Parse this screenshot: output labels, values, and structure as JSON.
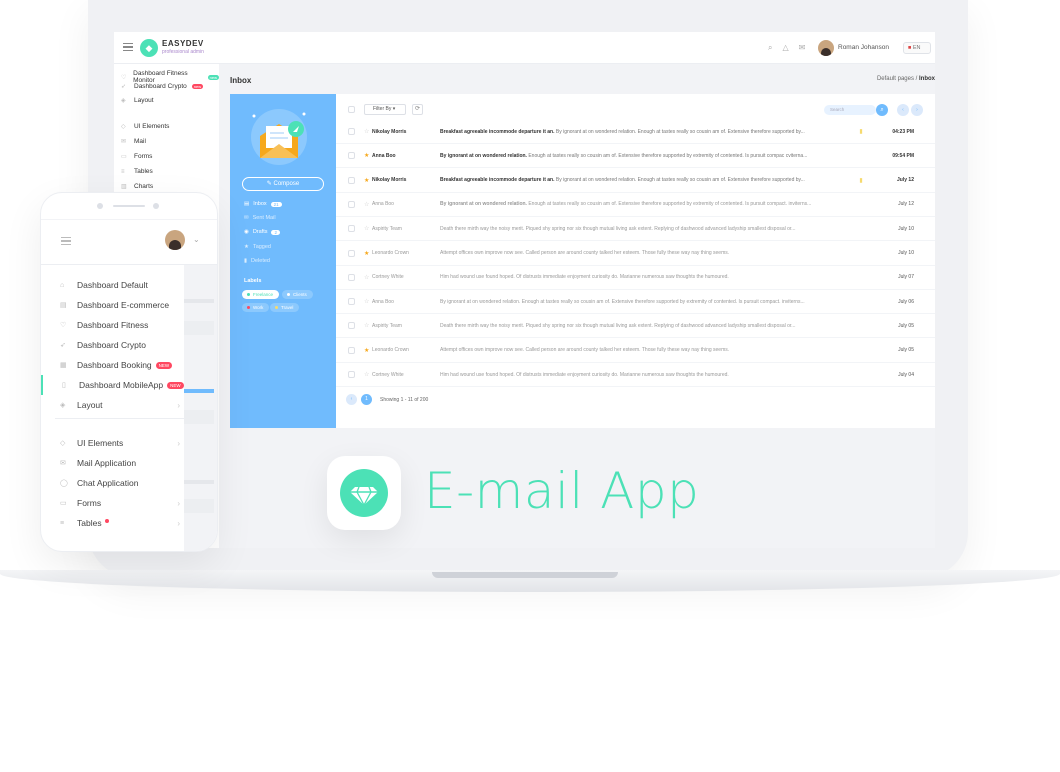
{
  "laptop": {
    "brand": {
      "name": "EASYDEV",
      "tagline": "professional admin"
    },
    "topbar": {
      "user": "Roman Johanson",
      "lang": "EN"
    },
    "sidebar": {
      "items": [
        {
          "label": "Dashboard Fitness Monitor",
          "badge": "new"
        },
        {
          "label": "Dashboard Crypto",
          "badge": "new"
        },
        {
          "label": "Layout"
        },
        {
          "label": "UI Elements"
        },
        {
          "label": "Mail"
        },
        {
          "label": "Forms"
        },
        {
          "label": "Tables"
        },
        {
          "label": "Charts"
        }
      ]
    },
    "page": {
      "title": "Inbox",
      "breadcrumb_parent": "Default pages",
      "breadcrumb_current": "Inbox"
    },
    "mail": {
      "compose": "Compose",
      "folders": [
        {
          "label": "Inbox",
          "count": "21"
        },
        {
          "label": "Sent Mail"
        },
        {
          "label": "Drafts",
          "count": "2"
        },
        {
          "label": "Tagged"
        },
        {
          "label": "Deleted"
        }
      ],
      "labels_title": "Labels",
      "labels": [
        {
          "label": "Freelance",
          "color": "#4ce1b6"
        },
        {
          "label": "Clients",
          "color": "#70bbfd"
        },
        {
          "label": "Work",
          "color": "#ff4861"
        },
        {
          "label": "Travel",
          "color": "#f6da6e"
        }
      ],
      "filter": "Filter By",
      "search_placeholder": "Search",
      "messages": [
        {
          "from": "Nikolay Morris",
          "subject": "Breakfast agreeable incommode departure it an.",
          "body": "By ignorant at on wondered relation. Enough at tastes really so cousin am of. Extensive therefore supported by...",
          "time": "04:23 PM",
          "unread": true,
          "starred": false,
          "attachment": true
        },
        {
          "from": "Anna Boo",
          "subject": "By ignorant at on wondered relation.",
          "body": "Enough at tastes really so cousin am of. Extensive therefore supported by extremity of contented. Is pursuit compac cviterna...",
          "time": "09:54 PM",
          "unread": true,
          "starred": true,
          "attachment": false
        },
        {
          "from": "Nikolay Morris",
          "subject": "Breakfast agreeable incommode departure it an.",
          "body": "By ignorant at on wondered relation. Enough at tastes really so cousin am of. Extensive therefore supported by...",
          "time": "July 12",
          "unread": true,
          "starred": true,
          "attachment": true
        },
        {
          "from": "Anna Boo",
          "subject": "By ignorant at on wondered relation.",
          "body": "Enough at tastes really so cousin am of. Extensive therefore supported by extremity of contented. Is pursuit compact. inviterns...",
          "time": "July 12",
          "unread": false,
          "starred": false,
          "attachment": false
        },
        {
          "from": "Aspirity Team",
          "subject": "",
          "body": "Death there mirth way the noisy merit. Piqued shy spring nor six though mutual living ask extent. Replying of dashwood advanced ladyship smallest disposal or...",
          "time": "July 10",
          "unread": false,
          "starred": false,
          "attachment": false
        },
        {
          "from": "Leonardo Crown",
          "subject": "",
          "body": "Attempt offices own improve now see. Called person are around county talked her esteem. Those fully these way nay thing seems.",
          "time": "July 10",
          "unread": false,
          "starred": true,
          "attachment": false
        },
        {
          "from": "Cortney White",
          "subject": "",
          "body": "Him had wound use found hoped. Of distrusts immediate enjoyment curiosity do. Marianne numerous saw thoughts the humoured.",
          "time": "July 07",
          "unread": false,
          "starred": false,
          "attachment": false
        },
        {
          "from": "Anna Boo",
          "subject": "",
          "body": "By ignorant at on wondered relation. Enough at tastes really so cousin am of. Extensive therefore supported by extremity of contented. Is pursuit compact. inviterns...",
          "time": "July 06",
          "unread": false,
          "starred": false,
          "attachment": false
        },
        {
          "from": "Aspirity Team",
          "subject": "",
          "body": "Death there mirth way the noisy merit. Piqued shy spring nor six though mutual living ask extent. Replying of dashwood advanced ladyship smallest disposal or...",
          "time": "July 05",
          "unread": false,
          "starred": false,
          "attachment": false
        },
        {
          "from": "Leonardo Crown",
          "subject": "",
          "body": "Attempt offices own improve now see. Called person are around county talked her esteem. Those fully these way nay thing seems.",
          "time": "July 05",
          "unread": false,
          "starred": true,
          "attachment": false
        },
        {
          "from": "Cortney White",
          "subject": "",
          "body": "Him had wound use found hoped. Of distrusts immediate enjoyment curiosity do. Marianne numerous saw thoughts the humoured.",
          "time": "July 04",
          "unread": false,
          "starred": false,
          "attachment": false
        }
      ],
      "pagination": {
        "current": "1",
        "showing": "Showing 1 - 11 of 200"
      }
    }
  },
  "phone": {
    "menu": [
      {
        "label": "Dashboard Default",
        "icon": "home-icon"
      },
      {
        "label": "Dashboard E-commerce",
        "icon": "store-icon"
      },
      {
        "label": "Dashboard Fitness",
        "icon": "heart-icon"
      },
      {
        "label": "Dashboard Crypto",
        "icon": "rocket-icon"
      },
      {
        "label": "Dashboard Booking",
        "icon": "calendar-icon",
        "badge": "NEW"
      },
      {
        "label": "Dashboard MobileApp",
        "icon": "phone-icon",
        "badge": "NEW"
      },
      {
        "label": "Layout",
        "icon": "layers-icon"
      },
      {
        "label": "UI Elements",
        "icon": "diamond-icon"
      },
      {
        "label": "Mail Application",
        "icon": "envelope-icon"
      },
      {
        "label": "Chat Application",
        "icon": "chat-icon"
      },
      {
        "label": "Forms",
        "icon": "file-icon"
      },
      {
        "label": "Tables",
        "icon": "list-icon"
      }
    ]
  },
  "hero": {
    "title": "E-mail App"
  },
  "colors": {
    "accent": "#4ce1b6",
    "mail_blue": "#70bbfd",
    "danger": "#ff4861"
  }
}
